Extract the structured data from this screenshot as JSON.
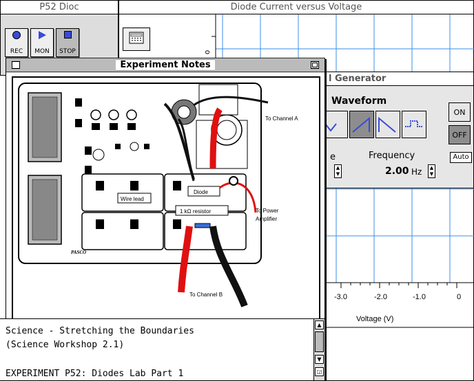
{
  "p52_window": {
    "title": "P52 Dioc",
    "buttons": [
      {
        "label": "REC",
        "icon": "record-icon"
      },
      {
        "label": "MON",
        "icon": "monitor-icon"
      },
      {
        "label": "STOP",
        "icon": "stop-icon"
      }
    ]
  },
  "graph_window": {
    "title": "Diode Current versus Voltage",
    "x_axis_label": "Voltage (V)",
    "x_ticks": [
      "-3.0",
      "-2.0",
      "-1.0",
      "0"
    ],
    "y_tick_visible": "o"
  },
  "signal_generator": {
    "title_fragment": "l Generator",
    "waveform_label": "Waveform",
    "on_label": "ON",
    "off_label": "OFF",
    "auto_label": "Auto",
    "amplitude_fragment": "e",
    "frequency_label": "Frequency",
    "frequency_value": "2.00",
    "frequency_unit": "Hz",
    "selected_waveform": "ramp-up"
  },
  "experiment_notes": {
    "title": "Experiment Notes",
    "diagram_labels": {
      "to_channel_a": "To Channel A",
      "diode": "Diode",
      "wire_lead": "Wire lead",
      "to_power_amplifier_1": "To Power",
      "to_power_amplifier_2": "Amplifier",
      "resistor": "1 kΩ resistor",
      "to_channel_b": "To Channel B"
    }
  },
  "text_pane": {
    "lines": [
      "Science - Stretching the Boundaries",
      "(Science Workshop 2.1)",
      "",
      "EXPERIMENT P52: Diodes Lab Part 1"
    ]
  },
  "colors": {
    "grid_blue": "#3b8ee8",
    "wire_red": "#e01010",
    "wire_black": "#111111",
    "button_blue": "#3a4bd8"
  }
}
